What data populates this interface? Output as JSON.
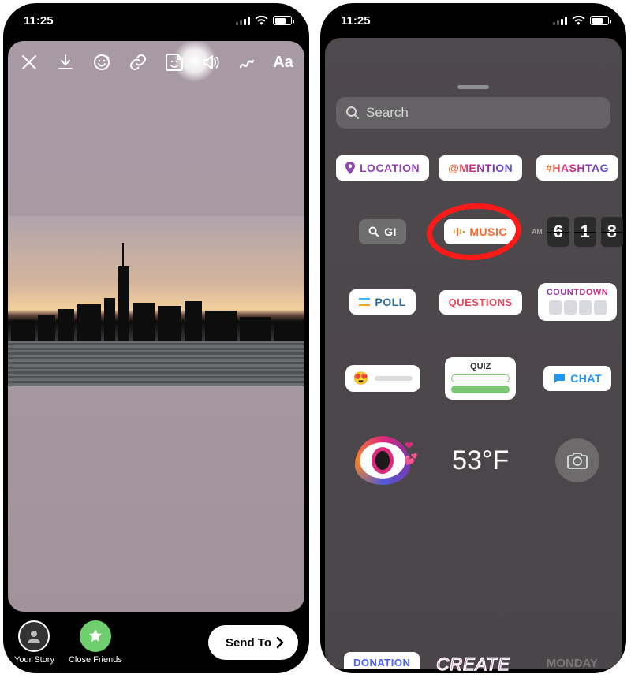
{
  "status": {
    "time": "11:25"
  },
  "left": {
    "toolbar": {
      "close": "close-icon",
      "save": "download-icon",
      "face": "face-effect-icon",
      "link": "link-icon",
      "sticker": "sticker-icon",
      "sound": "sound-icon",
      "draw": "draw-icon",
      "text": "Aa"
    },
    "bottom": {
      "yourStory": "Your Story",
      "closeFriends": "Close Friends",
      "sendTo": "Send To"
    }
  },
  "right": {
    "search": {
      "placeholder": "Search"
    },
    "chips": {
      "location": "LOCATION",
      "mention": "@MENTION",
      "hashtag": "#HASHTAG",
      "gif": "GI",
      "music": "MUSIC",
      "time": {
        "ampm": "AM",
        "d1": "6",
        "d2": "1",
        "d3": "8"
      },
      "poll": "POLL",
      "questions": "QUESTIONS",
      "countdown": "COUNTDOWN",
      "quiz": "QUIZ",
      "chat": "CHAT",
      "temp": "53°F",
      "donation": "DONATION",
      "create": "CREATE",
      "monday": "MONDAY"
    }
  }
}
